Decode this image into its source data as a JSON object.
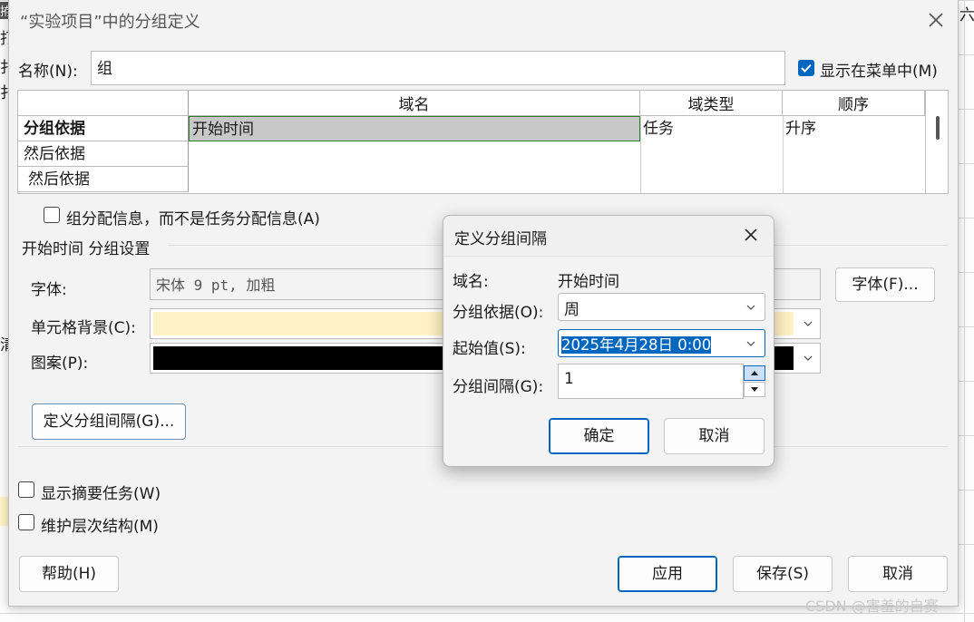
{
  "background_app": {
    "fragments": [
      "拵",
      "打",
      "扌",
      "清",
      "六"
    ]
  },
  "main_dialog": {
    "title": "“实验项目”中的分组定义",
    "name_label": "名称(N):",
    "name_value": "组",
    "show_in_menu_label": "显示在菜单中(M)",
    "show_in_menu_checked": true,
    "grid": {
      "columns": [
        "域名",
        "域类型",
        "顺序"
      ],
      "rows": [
        {
          "header": "分组依据",
          "field": "开始时间",
          "type": "任务",
          "order": "升序"
        },
        {
          "header": "然后依据",
          "field": "",
          "type": "",
          "order": ""
        },
        {
          "header": "然后依据",
          "field": "",
          "type": "",
          "order": ""
        }
      ]
    },
    "assignment_label": "组分配信息，而不是任务分配信息(A)",
    "assignment_checked": false,
    "settings_heading": "开始时间 分组设置",
    "font_label": "字体:",
    "font_value": "宋体 9 pt, 加粗",
    "font_button": "字体(F)...",
    "cell_bg_label": "单元格背景(C):",
    "cell_bg_color": "#fff2c4",
    "pattern_label": "图案(P):",
    "pattern_color": "#000000",
    "define_interval_button": "定义分组间隔(G)...",
    "show_summary_label": "显示摘要任务(W)",
    "show_summary_checked": false,
    "keep_hierarchy_label": "维护层次结构(M)",
    "keep_hierarchy_checked": false,
    "help_button": "帮助(H)",
    "apply_button": "应用",
    "save_button": "保存(S)",
    "cancel_button": "取消"
  },
  "interval_dialog": {
    "title": "定义分组间隔",
    "field_name_label": "域名:",
    "field_name_value": "开始时间",
    "group_on_label": "分组依据(O):",
    "group_on_value": "周",
    "start_at_label": "起始值(S):",
    "start_at_value": "2025年4月28日 0:00",
    "interval_label": "分组间隔(G):",
    "interval_value": "1",
    "ok_button": "确定",
    "cancel_button": "取消"
  },
  "watermark": "CSDN @害羞的自赛",
  "colors": {
    "accent": "#0067c0",
    "grid_selection": "#c8c8c8",
    "dialog_bg": "#f3f3f3"
  }
}
